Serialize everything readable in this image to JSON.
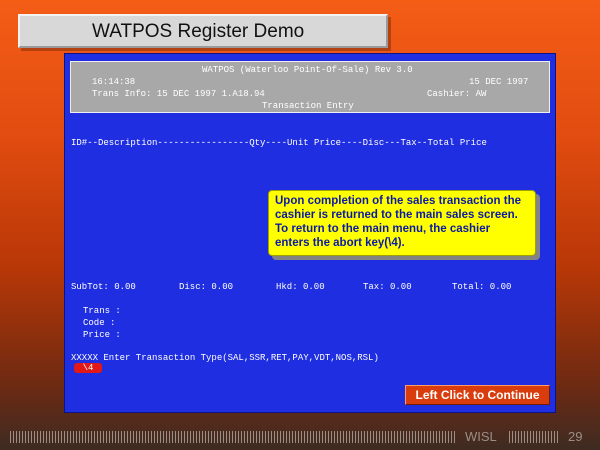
{
  "slide": {
    "title": "WATPOS Register Demo",
    "continue_label": "Left Click to Continue"
  },
  "terminal": {
    "header": {
      "system_title": "WATPOS (Waterloo Point-Of-Sale) Rev 3.0",
      "time": "16:14:38",
      "date": "15 DEC 1997",
      "trans_info": "Trans Info: 15 DEC 1997 1.A18.94",
      "cashier": "Cashier: AW",
      "screen_title": "Transaction Entry"
    },
    "columns_line": "ID#--Description-----------------Qty----Unit Price----Disc---Tax--Total Price",
    "totals": {
      "subtotal": "SubTot: 0.00",
      "disc": "Disc: 0.00",
      "hkd": "Hkd: 0.00",
      "tax": "Tax: 0.00",
      "total": "Total: 0.00"
    },
    "fields": {
      "trans": "Trans :",
      "code": "Code  :",
      "price": "Price :"
    },
    "prompt": "XXXXX Enter Transaction Type(SAL,SSR,RET,PAY,VDT,NOS,RSL)",
    "abort_key": "\\4"
  },
  "callout": {
    "line1": "Upon completion of the sales transaction the",
    "line2": "cashier is returned to the main sales screen.",
    "line3": "To return to the main menu, the cashier",
    "line4": "enters the abort key(\\4)."
  },
  "footer": {
    "label": "WISL",
    "page_number": "29"
  }
}
